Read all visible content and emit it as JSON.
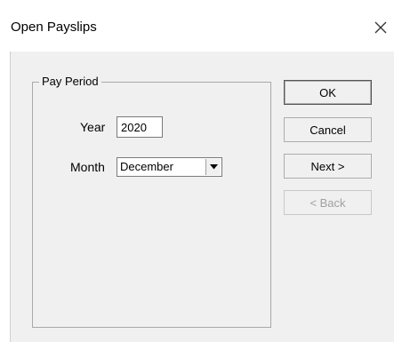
{
  "window": {
    "title": "Open Payslips"
  },
  "pay_period": {
    "group_label": "Pay Period",
    "year_label": "Year",
    "year_value": "2020",
    "month_label": "Month",
    "month_value": "December"
  },
  "buttons": {
    "ok": "OK",
    "cancel": "Cancel",
    "next": "Next >",
    "back": "< Back"
  },
  "icons": {
    "close": "close-icon",
    "dropdown": "chevron-down-icon"
  }
}
